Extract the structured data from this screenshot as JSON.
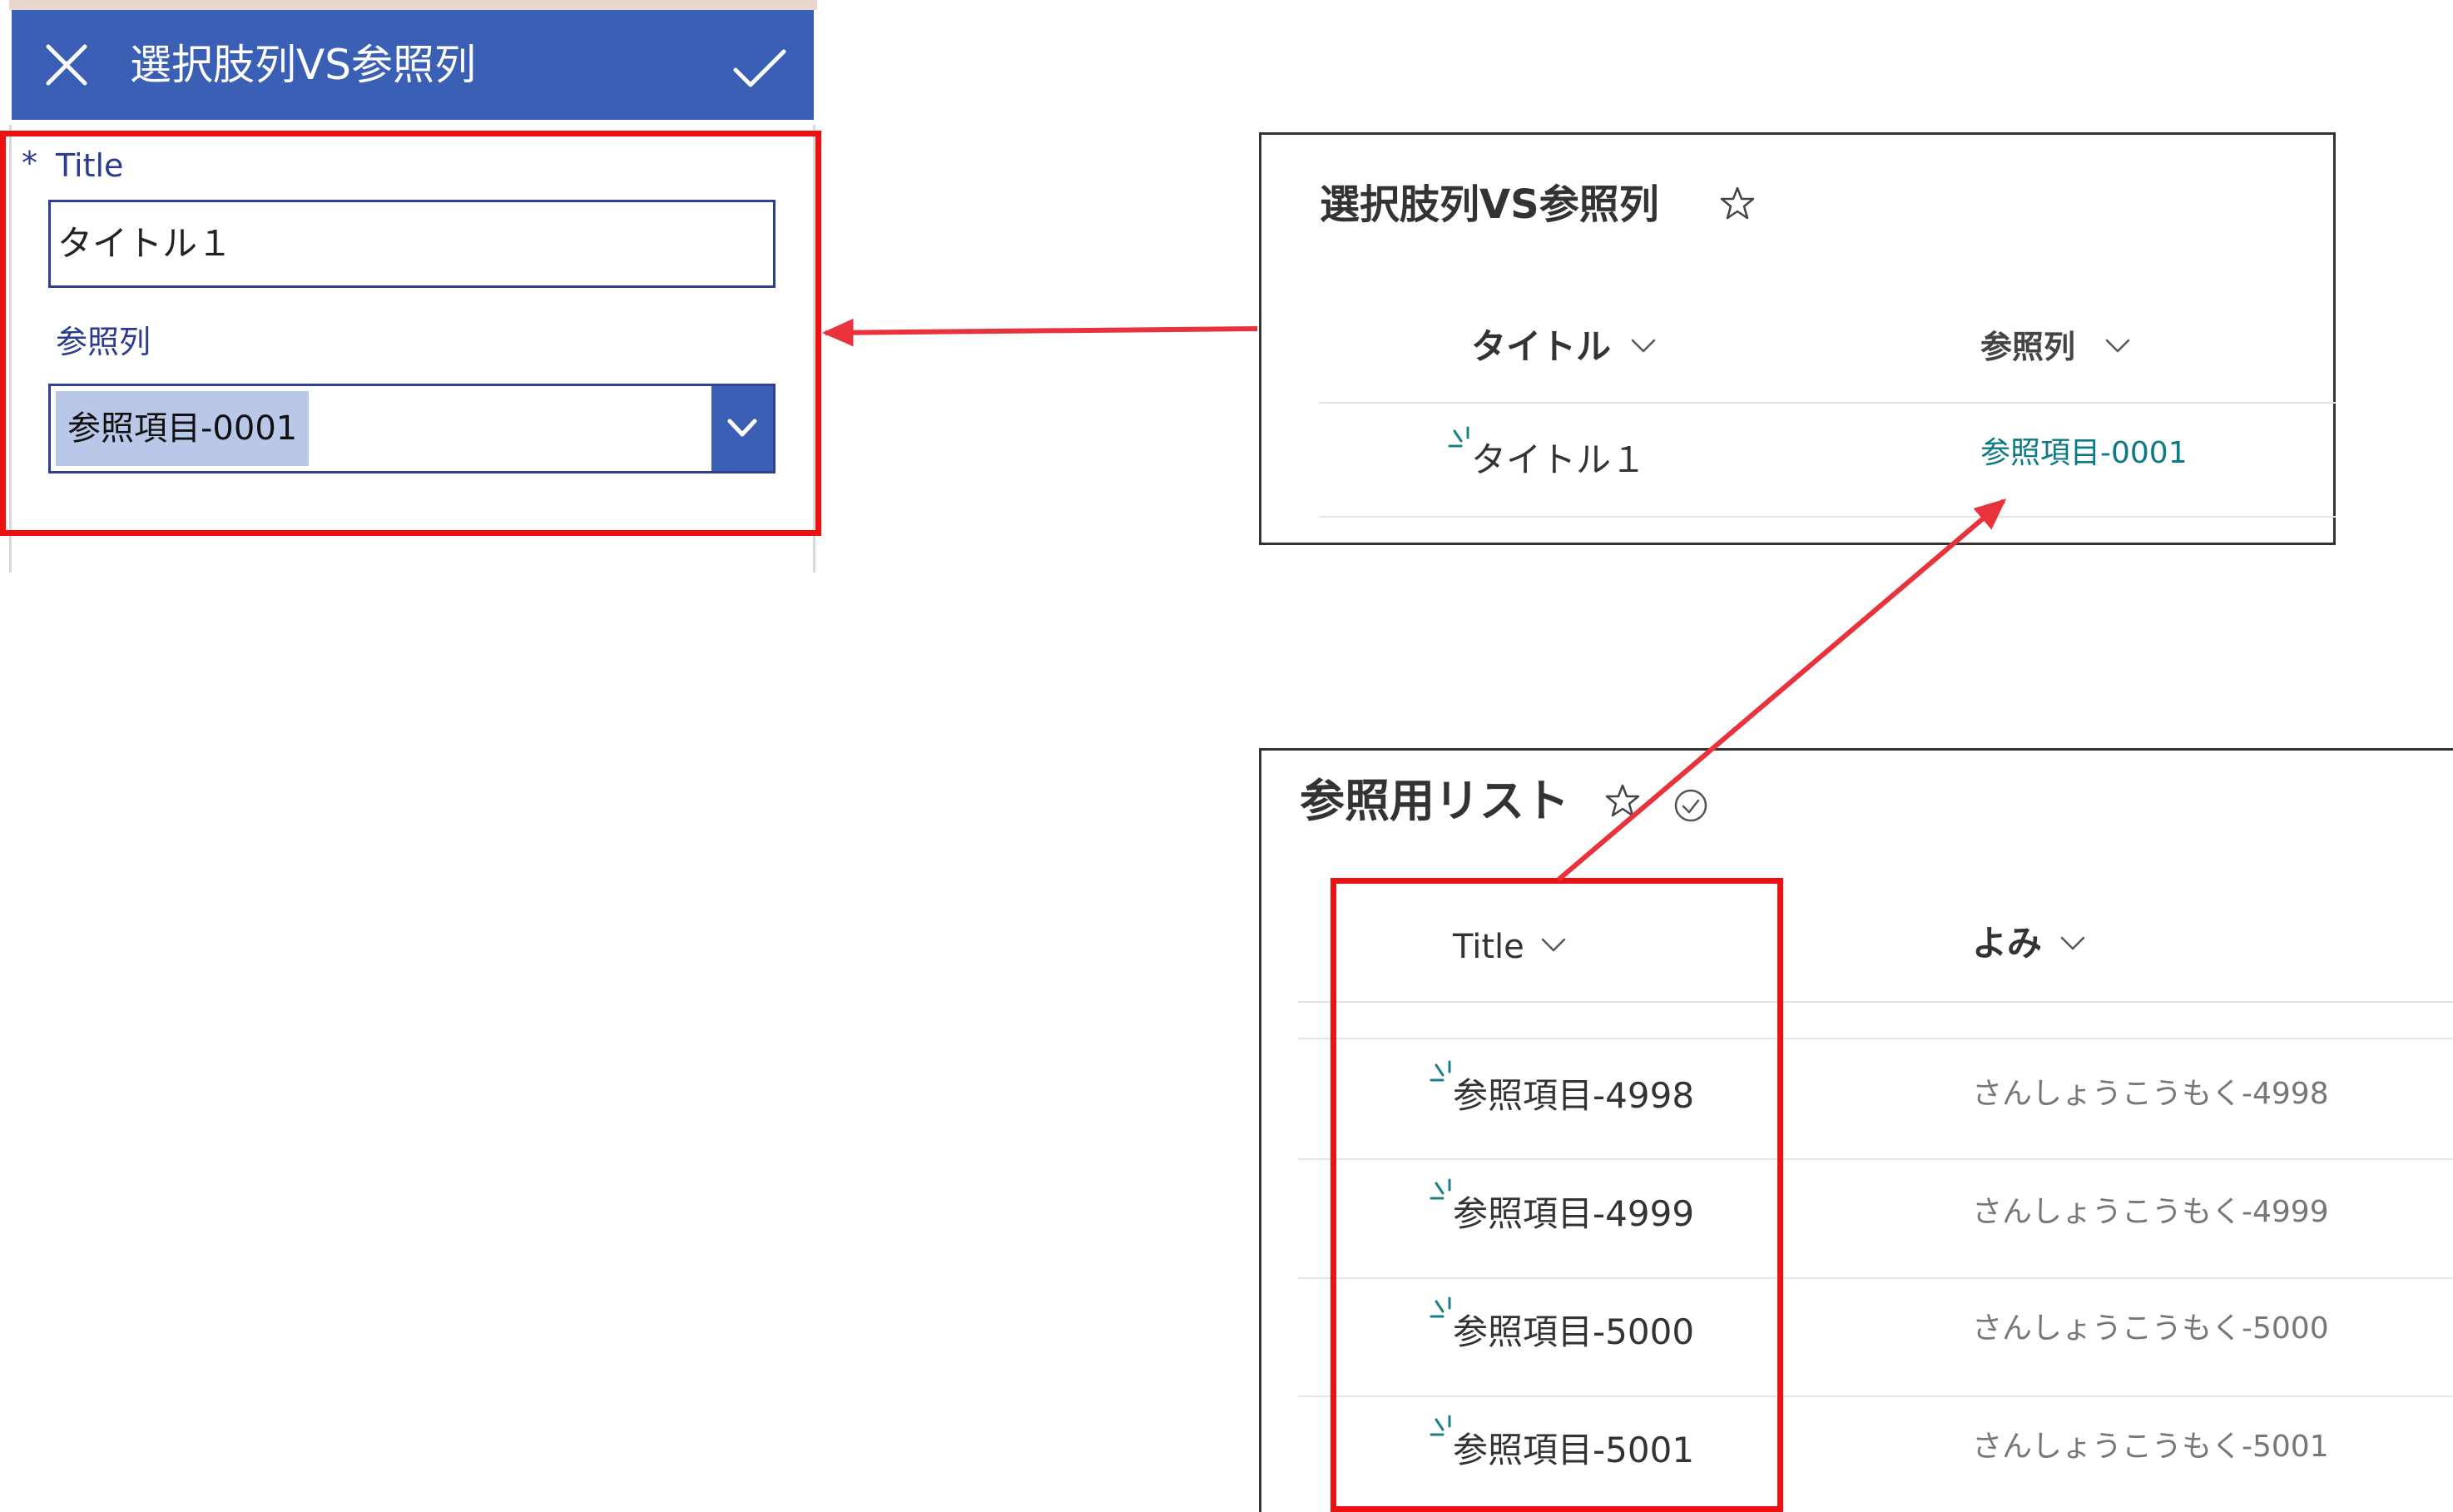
{
  "form": {
    "title": "選択肢列VS参照列",
    "fields": {
      "title": {
        "required_mark": "*",
        "label": "Title",
        "value": "タイトル１"
      },
      "lookup": {
        "label": "参照列",
        "selected": "参照項目-0001"
      }
    }
  },
  "list_main": {
    "title": "選択肢列VS参照列",
    "columns": {
      "title": "タイトル",
      "lookup": "参照列"
    },
    "rows": [
      {
        "title": "タイトル１",
        "lookup": "参照項目-0001"
      }
    ]
  },
  "list_ref": {
    "title": "参照用リスト",
    "columns": {
      "title": "Title",
      "yomi": "よみ"
    },
    "rows": [
      {
        "title": "参照項目-4998",
        "yomi": "さんしょうこうもく-4998"
      },
      {
        "title": "参照項目-4999",
        "yomi": "さんしょうこうもく-4999"
      },
      {
        "title": "参照項目-5000",
        "yomi": "さんしょうこうもく-5000"
      },
      {
        "title": "参照項目-5001",
        "yomi": "さんしょうこうもく-5001"
      }
    ]
  },
  "colors": {
    "form_header": "#3a5fb5",
    "highlight_red": "#ee1111",
    "arrow": "#e8323c",
    "lookup_link": "#0b7a83",
    "chip": "#b9c7e8"
  },
  "icons": {
    "close": "close-icon",
    "submit": "checkmark-icon",
    "dropdown": "chevron-down-icon",
    "favorite": "star-outline-icon",
    "sync": "check-circle-icon",
    "new_item": "new-item-sparkle-icon"
  }
}
